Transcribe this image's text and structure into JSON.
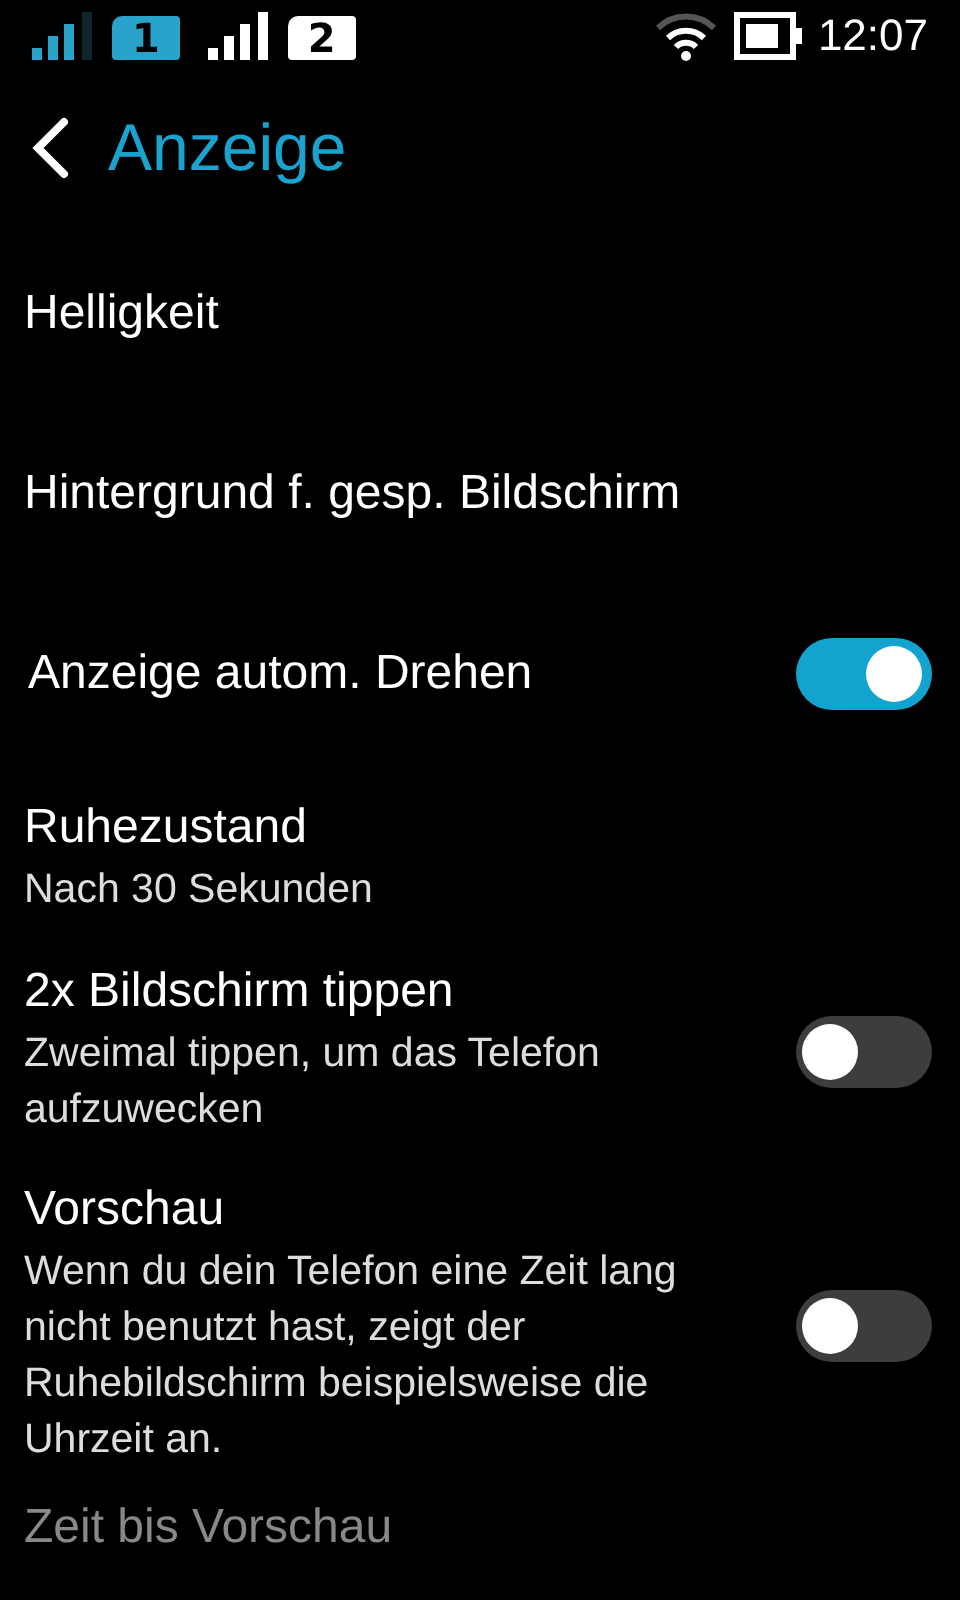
{
  "status_bar": {
    "sims": [
      {
        "label": "1",
        "active": true
      },
      {
        "label": "2",
        "active": false
      }
    ],
    "time": "12:07"
  },
  "header": {
    "title": "Anzeige"
  },
  "items": [
    {
      "kind": "plain",
      "title": "Helligkeit"
    },
    {
      "kind": "plain",
      "title": "Hintergrund f. gesp. Bildschirm"
    },
    {
      "kind": "toggle",
      "title": "Anzeige autom. Drehen",
      "on": true
    },
    {
      "kind": "summary",
      "title": "Ruhezustand",
      "summary": "Nach 30 Sekunden"
    },
    {
      "kind": "toggle",
      "title": "2x Bildschirm tippen",
      "summary": "Zweimal tippen, um das Telefon aufzuwecken",
      "on": false
    },
    {
      "kind": "toggle",
      "title": "Vorschau",
      "summary": "Wenn du dein Telefon eine Zeit lang nicht benutzt hast, zeigt der Ruhebildschirm beispielsweise die Uhrzeit an.",
      "on": false
    },
    {
      "kind": "disabled",
      "title": "Zeit bis Vorschau"
    }
  ]
}
